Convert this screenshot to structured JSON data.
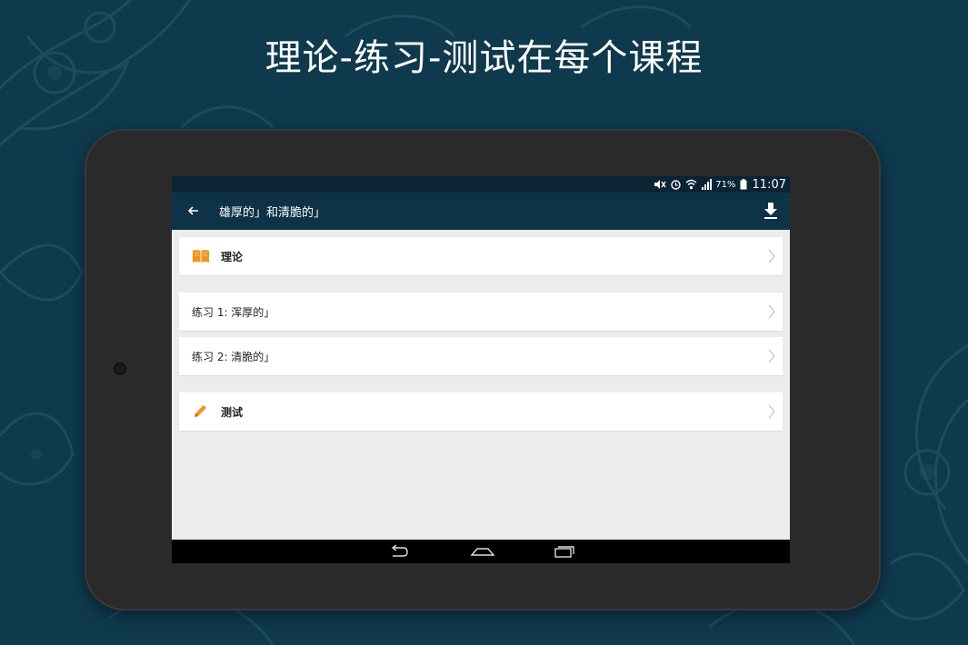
{
  "colors": {
    "background": "#0f3a4e",
    "appbar": "#0e3346",
    "statusbar": "#0a2433",
    "accent_orange": "#f0941e",
    "screen_bg": "#ececec"
  },
  "headline": "理论-练习-测试在每个课程",
  "status_bar": {
    "icons": [
      "mute-icon",
      "alarm-icon",
      "wifi-icon",
      "signal-icon",
      "battery-icon"
    ],
    "battery": "71%",
    "time": "11:07"
  },
  "app_bar": {
    "back_icon": "arrow-left-icon",
    "title": "雄厚的」和清脆的」",
    "download_icon": "download-icon"
  },
  "items": [
    {
      "icon": "book-icon",
      "label": "理论"
    },
    {
      "label": "练习 1: 浑厚的」"
    },
    {
      "label": "练习 2: 清脆的」"
    },
    {
      "icon": "pencil-icon",
      "label": "测试"
    }
  ],
  "nav_bar": {
    "buttons": [
      "back-nav-icon",
      "home-nav-icon",
      "recents-nav-icon"
    ]
  }
}
